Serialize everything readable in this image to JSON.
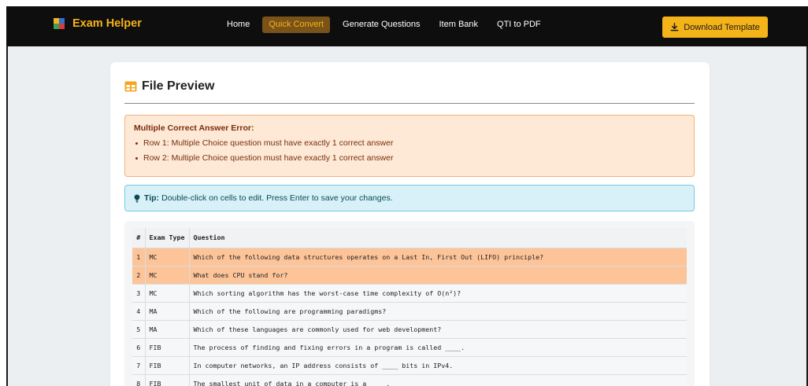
{
  "app": {
    "name": "Exam Helper",
    "logo_colors": [
      "#f5b31a",
      "#2f6fd1",
      "#3f9e58",
      "#d63c3c"
    ],
    "accent": "#f5b31a"
  },
  "nav": {
    "items": [
      {
        "label": "Home",
        "active": false
      },
      {
        "label": "Quick Convert",
        "active": true
      },
      {
        "label": "Generate Questions",
        "active": false
      },
      {
        "label": "Item Bank",
        "active": false
      },
      {
        "label": "QTI to PDF",
        "active": false
      }
    ],
    "download_label": "Download Template"
  },
  "card": {
    "title": "File Preview",
    "error": {
      "heading": "Multiple Correct Answer Error:",
      "items": [
        "Row 1: Multiple Choice question must have exactly 1 correct answer",
        "Row 2: Multiple Choice question must have exactly 1 correct answer"
      ]
    },
    "tip": {
      "bold": "Tip:",
      "text": "Double-click on cells to edit. Press Enter to save your changes."
    },
    "table": {
      "columns": [
        "#",
        "Exam Type",
        "Question"
      ],
      "rows": [
        {
          "num": "1",
          "type": "MC",
          "question": "Which of the following data structures operates on a Last In, First Out (LIFO) principle?",
          "error": true
        },
        {
          "num": "2",
          "type": "MC",
          "question": "What does CPU stand for?",
          "error": true
        },
        {
          "num": "3",
          "type": "MC",
          "question": "Which sorting algorithm has the worst-case time complexity of O(n²)?",
          "error": false
        },
        {
          "num": "4",
          "type": "MA",
          "question": "Which of the following are programming paradigms?",
          "error": false
        },
        {
          "num": "5",
          "type": "MA",
          "question": "Which of these languages are commonly used for web development?",
          "error": false
        },
        {
          "num": "6",
          "type": "FIB",
          "question": "The process of finding and fixing errors in a program is called ____.",
          "error": false
        },
        {
          "num": "7",
          "type": "FIB",
          "question": "In computer networks, an IP address consists of ____ bits in IPv4.",
          "error": false
        },
        {
          "num": "8",
          "type": "FIB",
          "question": "The smallest unit of data in a computer is a ____.",
          "error": false
        }
      ]
    }
  }
}
